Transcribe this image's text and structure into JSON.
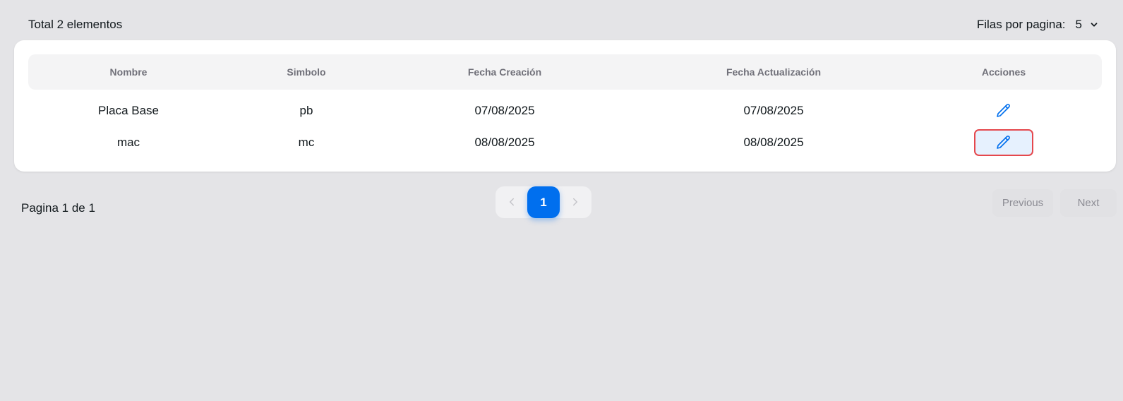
{
  "summary": {
    "total_label": "Total 2 elementos"
  },
  "rows_per_page": {
    "label": "Filas por pagina:",
    "value": "5"
  },
  "table": {
    "headers": [
      "Nombre",
      "Simbolo",
      "Fecha Creación",
      "Fecha Actualización",
      "Acciones"
    ],
    "rows": [
      {
        "nombre": "Placa Base",
        "simbolo": "pb",
        "fecha_creacion": "07/08/2025",
        "fecha_actualizacion": "07/08/2025"
      },
      {
        "nombre": "mac",
        "simbolo": "mc",
        "fecha_creacion": "08/08/2025",
        "fecha_actualizacion": "08/08/2025"
      }
    ]
  },
  "pagination": {
    "page_info": "Pagina 1 de 1",
    "current_page": "1",
    "previous_label": "Previous",
    "next_label": "Next"
  },
  "colors": {
    "accent": "#006fee",
    "focus_ring": "#e5484d",
    "edit_icon": "#006fee"
  },
  "icons": {
    "edit": "pencil-icon",
    "dropdown": "chevron-down-icon",
    "prev": "chevron-left-icon",
    "next": "chevron-right-icon"
  }
}
